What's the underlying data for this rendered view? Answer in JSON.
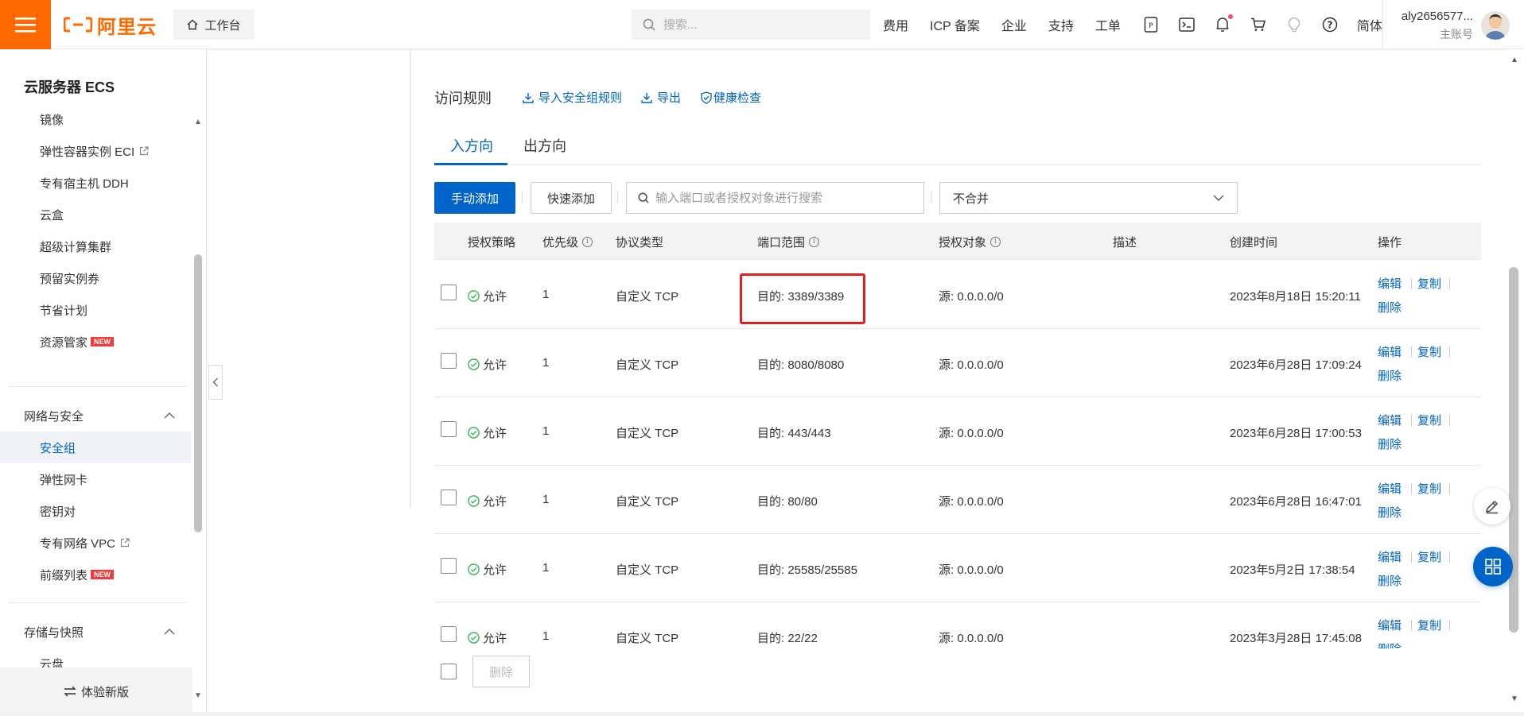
{
  "header": {
    "logo_text": "阿里云",
    "workbench_label": "工作台",
    "search_placeholder": "搜索...",
    "links": [
      "费用",
      "ICP 备案",
      "企业",
      "支持",
      "工单"
    ],
    "language": "简体",
    "account_name": "aly2656577...",
    "account_type": "主账号"
  },
  "sidebar": {
    "title": "云服务器 ECS",
    "items_top": [
      {
        "label": "镜像"
      },
      {
        "label": "弹性容器实例 ECI"
      },
      {
        "label": "专有宿主机 DDH"
      },
      {
        "label": "云盒"
      },
      {
        "label": "超级计算集群"
      },
      {
        "label": "预留实例券"
      },
      {
        "label": "节省计划"
      },
      {
        "label": "资源管家"
      }
    ],
    "group_network": "网络与安全",
    "items_network": [
      {
        "label": "安全组"
      },
      {
        "label": "弹性网卡"
      },
      {
        "label": "密钥对"
      },
      {
        "label": "专有网络 VPC"
      },
      {
        "label": "前缀列表"
      }
    ],
    "group_storage": "存储与快照",
    "items_storage": [
      {
        "label": "云盘"
      }
    ],
    "new_badge": "NEW",
    "bottom_label": "体验新版"
  },
  "main": {
    "section_title": "访问规则",
    "actions": {
      "import": "导入安全组规则",
      "export": "导出",
      "health": "健康检查"
    },
    "tabs": [
      "入方向",
      "出方向"
    ],
    "toolbar": {
      "manual_add": "手动添加",
      "quick_add": "快速添加",
      "search_placeholder": "输入端口或者授权对象进行搜索",
      "merge_select": "不合并"
    },
    "table": {
      "columns": [
        "授权策略",
        "优先级",
        "协议类型",
        "端口范围",
        "授权对象",
        "描述",
        "创建时间",
        "操作"
      ],
      "rows": [
        {
          "policy": "允许",
          "priority": "1",
          "protocol": "自定义 TCP",
          "port": "目的: 3389/3389",
          "source": "源: 0.0.0.0/0",
          "desc": "",
          "created": "2023年8月18日 15:20:11"
        },
        {
          "policy": "允许",
          "priority": "1",
          "protocol": "自定义 TCP",
          "port": "目的: 8080/8080",
          "source": "源: 0.0.0.0/0",
          "desc": "",
          "created": "2023年6月28日 17:09:24"
        },
        {
          "policy": "允许",
          "priority": "1",
          "protocol": "自定义 TCP",
          "port": "目的: 443/443",
          "source": "源: 0.0.0.0/0",
          "desc": "",
          "created": "2023年6月28日 17:00:53"
        },
        {
          "policy": "允许",
          "priority": "1",
          "protocol": "自定义 TCP",
          "port": "目的: 80/80",
          "source": "源: 0.0.0.0/0",
          "desc": "",
          "created": "2023年6月28日 16:47:01"
        },
        {
          "policy": "允许",
          "priority": "1",
          "protocol": "自定义 TCP",
          "port": "目的: 25585/25585",
          "source": "源: 0.0.0.0/0",
          "desc": "",
          "created": "2023年5月2日 17:38:54"
        },
        {
          "policy": "允许",
          "priority": "1",
          "protocol": "自定义 TCP",
          "port": "目的: 22/22",
          "source": "源: 0.0.0.0/0",
          "desc": "",
          "created": "2023年3月28日 17:45:08"
        }
      ],
      "ops": {
        "edit": "编辑",
        "copy": "复制",
        "delete": "删除"
      }
    },
    "bulk_delete": "删除"
  },
  "colors": {
    "brand": "#ff6a00",
    "primary": "#0064c8",
    "success": "#2bb24c",
    "highlight": "#e02020"
  }
}
